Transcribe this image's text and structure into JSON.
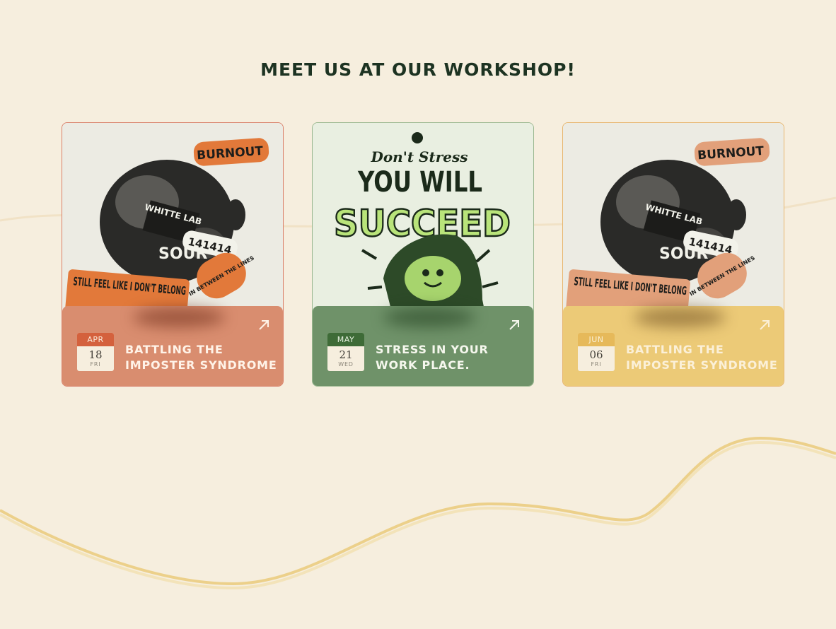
{
  "heading": "MEET US AT OUR WORKSHOP!",
  "colors": {
    "background": "#f6eede",
    "heading": "#1d3322",
    "wave_stroke": "#ecd08a"
  },
  "cards": [
    {
      "title": "BATTLING THE IMPOSTER SYNDROME",
      "month": "APR",
      "day": "18",
      "weekday": "FRI",
      "accent": "#d98d6f",
      "poster": {
        "icon": "burnout-poster-image",
        "badge_top": "BURNOUT",
        "tag": "WHITTE LAB",
        "number": "141414",
        "letters": "SOUR",
        "bottom_text": "STILL FEEL LIKE I DON'T BELONG",
        "sticker": "IN BETWEEN THE LINES"
      }
    },
    {
      "title": "STRESS IN YOUR WORK PLACE.",
      "month": "MAY",
      "day": "21",
      "weekday": "WED",
      "accent": "#6f9269",
      "poster": {
        "icon": "succeed-poster-image",
        "line1": "Don't Stress",
        "line2": "YOU WILL",
        "line3": "SUCCEED"
      }
    },
    {
      "title": "BATTLING THE IMPOSTER SYNDROME",
      "month": "JUN",
      "day": "06",
      "weekday": "FRI",
      "accent": "#ecca77",
      "poster": {
        "icon": "burnout-poster-image",
        "badge_top": "BURNOUT",
        "tag": "WHITTE LAB",
        "number": "141414",
        "letters": "SOUR",
        "bottom_text": "STILL FEEL LIKE I DON'T BELONG",
        "sticker": "IN BETWEEN THE LINES"
      }
    }
  ]
}
